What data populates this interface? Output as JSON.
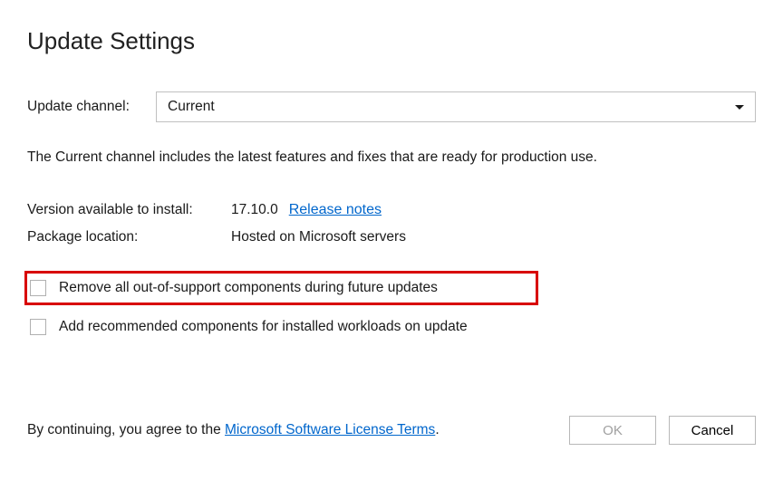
{
  "title": "Update Settings",
  "channel": {
    "label": "Update channel:",
    "selected": "Current"
  },
  "description": "The Current channel includes the latest features and fixes that are ready for production use.",
  "info": {
    "version_label": "Version available to install:",
    "version_value": "17.10.0",
    "release_notes_link": "Release notes",
    "package_label": "Package location:",
    "package_value": "Hosted on Microsoft servers"
  },
  "checkboxes": {
    "remove_oos": "Remove all out-of-support components during future updates",
    "add_recommended": "Add recommended components for installed workloads on update"
  },
  "footer": {
    "prefix": "By continuing, you agree to the ",
    "license_link": "Microsoft Software License Terms",
    "suffix": "."
  },
  "buttons": {
    "ok": "OK",
    "cancel": "Cancel"
  }
}
